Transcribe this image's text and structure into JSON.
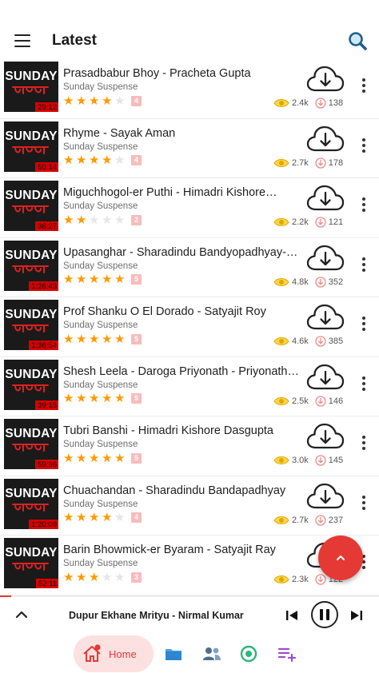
{
  "header": {
    "title": "Latest"
  },
  "items": [
    {
      "title": "Prasadbabur Bhoy - Pracheta Gupta",
      "category": "Sunday Suspense",
      "duration": "29:12",
      "rating": 4,
      "rating_badge": "4",
      "views": "2.4k",
      "downloads": "138"
    },
    {
      "title": "Rhyme - Sayak Aman",
      "category": "Sunday Suspense",
      "duration": "50:14",
      "rating": 4,
      "rating_badge": "4",
      "views": "2.7k",
      "downloads": "178"
    },
    {
      "title": "Miguchhogol-er Puthi - Himadri Kishore…",
      "category": "Sunday Suspense",
      "duration": "36:27",
      "rating": 2,
      "rating_badge": "2",
      "views": "2.2k",
      "downloads": "121"
    },
    {
      "title": "Upasanghar - Sharadindu Bandyopadhyay-…",
      "category": "Sunday Suspense",
      "duration": "1:26:43",
      "rating": 5,
      "rating_badge": "5",
      "views": "4.8k",
      "downloads": "352"
    },
    {
      "title": "Prof Shanku O El Dorado - Satyajit Roy",
      "category": "Sunday Suspense",
      "duration": "1:36:54",
      "rating": 5,
      "rating_badge": "5",
      "views": "4.6k",
      "downloads": "385"
    },
    {
      "title": "Shesh Leela - Daroga Priyonath - Priyonath…",
      "category": "Sunday Suspense",
      "duration": "39:15",
      "rating": 5,
      "rating_badge": "5",
      "views": "2.5k",
      "downloads": "146"
    },
    {
      "title": "Tubri Banshi - Himadri Kishore Dasgupta",
      "category": "Sunday Suspense",
      "duration": "59:36",
      "rating": 5,
      "rating_badge": "5",
      "views": "3.0k",
      "downloads": "145"
    },
    {
      "title": "Chuachandan - Sharadindu Bandapadhyay",
      "category": "Sunday Suspense",
      "duration": "1:20:09",
      "rating": 4,
      "rating_badge": "4",
      "views": "2.7k",
      "downloads": "237"
    },
    {
      "title": "Barin Bhowmick-er Byaram - Satyajit Ray",
      "category": "Sunday Suspense",
      "duration": "52:11",
      "rating": 3,
      "rating_badge": "3",
      "views": "2.3k",
      "downloads": "122"
    }
  ],
  "thumb_text": "SUNDAY",
  "player": {
    "now_playing": "Dupur Ekhane Mrityu - Nirmal Kumar",
    "progress": 0.03
  },
  "nav": {
    "home_label": "Home"
  },
  "icons": {
    "menu": "menu-icon",
    "search": "search-icon",
    "download": "cloud-download-icon",
    "more": "more-vertical-icon",
    "views": "eye-icon",
    "downloads": "download-small-icon",
    "fab": "chevron-up-icon",
    "prev": "skip-previous-icon",
    "pause": "pause-icon",
    "next": "skip-next-icon",
    "home": "home-icon",
    "folder": "folder-icon",
    "authors": "authors-icon",
    "record": "record-icon",
    "playlist": "playlist-add-icon"
  },
  "colors": {
    "accent": "#e53935",
    "star": "#ff9a00",
    "duration_badge": "#d50000",
    "home_pill": "#fde0e0"
  }
}
